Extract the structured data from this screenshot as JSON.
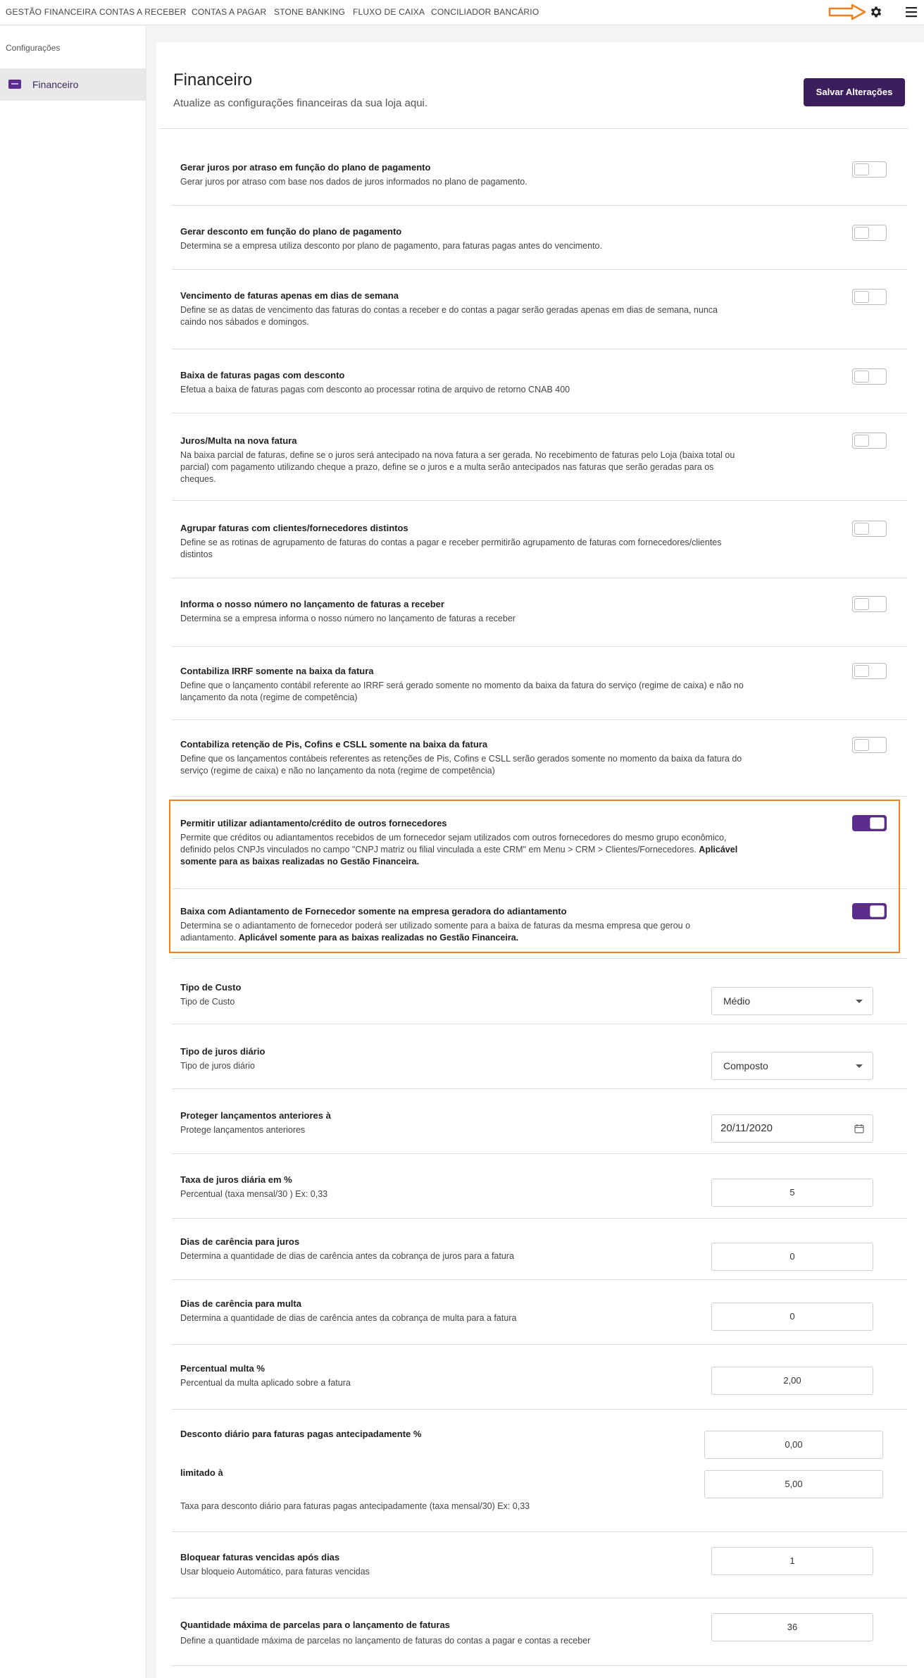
{
  "topnav": {
    "items": [
      "GESTÃO FINANCEIRA",
      "CONTAS A RECEBER",
      "CONTAS A PAGAR",
      "STONE BANKING",
      "FLUXO DE CAIXA",
      "CONCILIADOR BANCÁRIO"
    ]
  },
  "sidebar": {
    "title": "Configurações",
    "items": [
      {
        "label": "Financeiro",
        "icon": "money-icon"
      }
    ]
  },
  "header": {
    "title": "Financeiro",
    "subtitle": "Atualize as configurações financeiras da sua loja aqui.",
    "save_label": "Salvar Alterações"
  },
  "toggles": [
    {
      "title": "Gerar juros por atraso em função do plano de pagamento",
      "desc": "Gerar juros por atraso com base nos dados de juros informados no plano de pagamento.",
      "on": false
    },
    {
      "title": "Gerar desconto em função do plano de pagamento",
      "desc": "Determina se a empresa utiliza desconto por plano de pagamento, para faturas pagas antes do vencimento.",
      "on": false
    },
    {
      "title": "Vencimento de faturas apenas em dias de semana",
      "desc": "Define se as datas de vencimento das faturas do contas a receber e do contas a pagar serão geradas apenas em dias de semana, nunca caindo nos sábados e domingos.",
      "on": false
    },
    {
      "title": "Baixa de faturas pagas com desconto",
      "desc": "Efetua a baixa de faturas pagas com desconto ao processar rotina de arquivo de retorno CNAB 400",
      "on": false
    },
    {
      "title": "Juros/Multa na nova fatura",
      "desc": "Na baixa parcial de faturas, define se o juros será antecipado na nova fatura a ser gerada. No recebimento de faturas pelo Loja (baixa total ou parcial) com pagamento utilizando cheque a prazo, define se o juros e a multa serão antecipados nas faturas que serão geradas para os cheques.",
      "on": false
    },
    {
      "title": "Agrupar faturas com clientes/fornecedores distintos",
      "desc": "Define se as rotinas de agrupamento de faturas do contas a pagar e receber permitirão agrupamento de faturas com fornecedores/clientes distintos",
      "on": false
    },
    {
      "title": "Informa o nosso número no lançamento de faturas a receber",
      "desc": "Determina se a empresa informa o nosso número no lançamento de faturas a receber",
      "on": false
    },
    {
      "title": "Contabiliza IRRF somente na baixa da fatura",
      "desc": "Define que o lançamento contábil referente ao IRRF será gerado somente no momento da baixa da fatura do serviço (regime de caixa) e não no lançamento da nota (regime de competência)",
      "on": false
    },
    {
      "title": "Contabiliza retenção de Pis, Cofins e CSLL somente na baixa da fatura",
      "desc": "Define que os lançamentos contábeis referentes as retenções de Pis, Cofins e CSLL serão gerados somente no momento da baixa da fatura do serviço (regime de caixa) e não no lançamento da nota (regime de competência)",
      "on": false
    },
    {
      "title": "Permitir utilizar adiantamento/crédito de outros fornecedores",
      "desc": "Permite que créditos ou adiantamentos recebidos de um fornecedor sejam utilizados com outros fornecedores do mesmo grupo econômico, definido pelos CNPJs vinculados no campo \"CNPJ matriz ou filial vinculada a este CRM\" em Menu > CRM > Clientes/Fornecedores.",
      "bold": "Aplicável somente para as baixas realizadas no Gestão Financeira.",
      "on": true
    },
    {
      "title": "Baixa com Adiantamento de Fornecedor somente na empresa geradora do adiantamento",
      "desc": "Determina se o adiantamento de fornecedor poderá ser utilizado somente para a baixa de faturas da mesma empresa que gerou o adiantamento.",
      "bold": "Aplicável somente para as baixas realizadas no Gestão Financeira.",
      "on": true
    }
  ],
  "fields": {
    "tipo_custo": {
      "title": "Tipo de Custo",
      "desc": "Tipo de Custo",
      "value": "Médio"
    },
    "tipo_juros": {
      "title": "Tipo de juros diário",
      "desc": "Tipo de juros diário",
      "value": "Composto"
    },
    "proteger": {
      "title": "Proteger lançamentos anteriores à",
      "desc": "Protege lançamentos anteriores",
      "value": "20/11/2020"
    },
    "taxa_juros": {
      "title": "Taxa de juros diária em %",
      "desc": "Percentual (taxa mensal/30 ) Ex: 0,33",
      "value": "5"
    },
    "carencia_juros": {
      "title": "Dias de carência para juros",
      "desc": "Determina a quantidade de dias de carência antes da cobrança de juros para a fatura",
      "value": "0"
    },
    "carencia_multa": {
      "title": "Dias de carência para multa",
      "desc": "Determina a quantidade de dias de carência antes da cobrança de multa para a fatura",
      "value": "0"
    },
    "percentual_multa": {
      "title": "Percentual multa %",
      "desc": "Percentual da multa aplicado sobre a fatura",
      "value": "2,00"
    },
    "desconto": {
      "title": "Desconto diário para faturas pagas antecipadamente %",
      "value": "0,00",
      "limit_label": "limitado à",
      "limit_value": "5,00",
      "desc": "Taxa para desconto diário para faturas pagas antecipadamente (taxa mensal/30) Ex: 0,33"
    },
    "bloquear": {
      "title": "Bloquear faturas vencidas após dias",
      "desc": "Usar bloqueio Automático, para faturas vencidas",
      "value": "1"
    },
    "parcelas": {
      "title": "Quantidade máxima de parcelas para o lançamento de faturas",
      "desc": "Define a quantidade máxima de parcelas no lançamento de faturas do contas a pagar e contas a receber",
      "value": "36"
    }
  },
  "colors": {
    "accent": "#5c2c8c",
    "button": "#3d1e5c",
    "highlight": "#f07f1d"
  }
}
